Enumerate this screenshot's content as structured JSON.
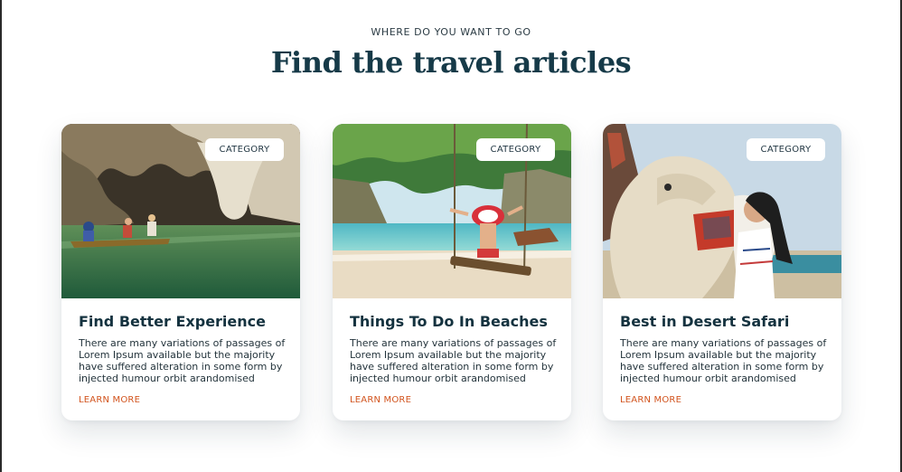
{
  "section": {
    "eyebrow": "WHERE DO YOU WANT TO GO",
    "title": "Find the travel articles"
  },
  "cards": [
    {
      "image": "cave-boat-photo",
      "badge": "CATEGORY",
      "title": "Find Better Experience",
      "text": "There are many variations of passages of Lorem Ipsum available but the majority have suffered alteration in some form by injected humour orbit arandomised",
      "link": "LEARN MORE"
    },
    {
      "image": "beach-swing-photo",
      "badge": "CATEGORY",
      "title": "Things To Do In Beaches",
      "text": "There are many variations of passages of Lorem Ipsum available but the majority have suffered alteration in some form by injected humour orbit arandomised",
      "link": "LEARN MORE"
    },
    {
      "image": "camel-desert-photo",
      "badge": "CATEGORY",
      "title": "Best in Desert Safari",
      "text": "There are many variations of passages of Lorem Ipsum available but the majority have suffered alteration in some form by injected humour orbit arandomised",
      "link": "LEARN MORE"
    }
  ],
  "colors": {
    "heading": "#163a48",
    "link": "#d2541e",
    "card_bg": "#ffffff"
  }
}
